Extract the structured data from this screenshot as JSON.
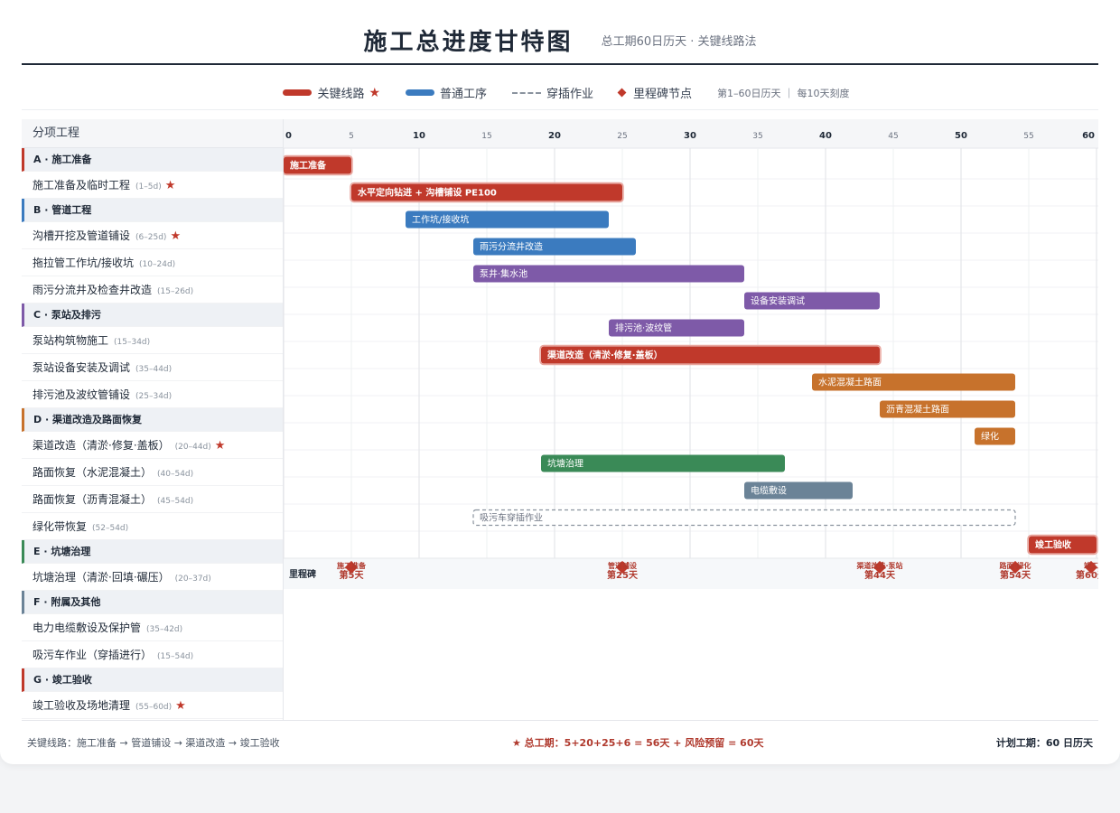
{
  "header": {
    "title": "施工总进度甘特图",
    "subtitle": "总工期60日历天 · 关键线路法"
  },
  "legend": {
    "critical": "关键线路",
    "normal": "普通工序",
    "inserted": "穿插作业",
    "milestone": "里程碑节点",
    "star": "★",
    "note": "第1–60日历天 ｜ 每10天刻度"
  },
  "left_header": "分项工程",
  "colors": {
    "critical": "#c0392b",
    "blue": "#3b7bbf",
    "purple": "#7e5aa8",
    "orange": "#c7722c",
    "green": "#3a8a57",
    "slate": "#6b8397",
    "dash": "#8a939e"
  },
  "rows": [
    {
      "type": "group",
      "label": "A · 施工准备",
      "color": "#c0392b"
    },
    {
      "type": "task",
      "label": "施工准备及临时工程",
      "dur": "(1–5d)",
      "critical": true
    },
    {
      "type": "group",
      "label": "B · 管道工程",
      "color": "#3b7bbf"
    },
    {
      "type": "task",
      "label": "沟槽开挖及管道铺设",
      "dur": "(6–25d)",
      "critical": true
    },
    {
      "type": "task",
      "label": "拖拉管工作坑/接收坑",
      "dur": "(10–24d)",
      "critical": false
    },
    {
      "type": "task",
      "label": "雨污分流井及检查井改造",
      "dur": "(15–26d)",
      "critical": false
    },
    {
      "type": "group",
      "label": "C · 泵站及排污",
      "color": "#7e5aa8"
    },
    {
      "type": "task",
      "label": "泵站构筑物施工",
      "dur": "(15–34d)",
      "critical": false
    },
    {
      "type": "task",
      "label": "泵站设备安装及调试",
      "dur": "(35–44d)",
      "critical": false
    },
    {
      "type": "task",
      "label": "排污池及波纹管铺设",
      "dur": "(25–34d)",
      "critical": false
    },
    {
      "type": "group",
      "label": "D · 渠道改造及路面恢复",
      "color": "#c7722c"
    },
    {
      "type": "task",
      "label": "渠道改造（清淤·修复·盖板）",
      "dur": "(20–44d)",
      "critical": true
    },
    {
      "type": "task",
      "label": "路面恢复（水泥混凝土）",
      "dur": "(40–54d)",
      "critical": false
    },
    {
      "type": "task",
      "label": "路面恢复（沥青混凝土）",
      "dur": "(45–54d)",
      "critical": false
    },
    {
      "type": "task",
      "label": "绿化带恢复",
      "dur": "(52–54d)",
      "critical": false
    },
    {
      "type": "group",
      "label": "E · 坑塘治理",
      "color": "#3a8a57"
    },
    {
      "type": "task",
      "label": "坑塘治理（清淤·回填·碾压）",
      "dur": "(20–37d)",
      "critical": false
    },
    {
      "type": "group",
      "label": "F · 附属及其他",
      "color": "#6b8397"
    },
    {
      "type": "task",
      "label": "电力电缆敷设及保护管",
      "dur": "(35–42d)",
      "critical": false
    },
    {
      "type": "task",
      "label": "吸污车作业（穿插进行）",
      "dur": "(15–54d)",
      "critical": false
    },
    {
      "type": "group",
      "label": "G · 竣工验收",
      "color": "#c0392b"
    },
    {
      "type": "task",
      "label": "竣工验收及场地清理",
      "dur": "(55–60d)",
      "critical": true
    }
  ],
  "chart_data": {
    "type": "gantt",
    "x_range": [
      0,
      60
    ],
    "ticks": [
      0,
      5,
      10,
      15,
      20,
      25,
      30,
      35,
      40,
      45,
      50,
      55,
      60
    ],
    "bars": [
      {
        "label": "施工准备",
        "start": 0,
        "end": 5,
        "color": "#c0392b",
        "critical": true
      },
      {
        "label": "水平定向钻进 + 沟槽铺设 PE100",
        "start": 5,
        "end": 25,
        "color": "#c0392b",
        "critical": true
      },
      {
        "label": "工作坑/接收坑",
        "start": 9,
        "end": 24,
        "color": "#3b7bbf",
        "critical": false
      },
      {
        "label": "雨污分流井改造",
        "start": 14,
        "end": 26,
        "color": "#3b7bbf",
        "critical": false
      },
      {
        "label": "泵井·集水池",
        "start": 14,
        "end": 34,
        "color": "#7e5aa8",
        "critical": false
      },
      {
        "label": "设备安装调试",
        "start": 34,
        "end": 44,
        "color": "#7e5aa8",
        "critical": false
      },
      {
        "label": "排污池·波纹管",
        "start": 24,
        "end": 34,
        "color": "#7e5aa8",
        "critical": false
      },
      {
        "label": "渠道改造（清淤·修复·盖板）",
        "start": 19,
        "end": 44,
        "color": "#c0392b",
        "critical": true
      },
      {
        "label": "水泥混凝土路面",
        "start": 39,
        "end": 54,
        "color": "#c7722c",
        "critical": false
      },
      {
        "label": "沥青混凝土路面",
        "start": 44,
        "end": 54,
        "color": "#c7722c",
        "critical": false
      },
      {
        "label": "绿化",
        "start": 51,
        "end": 54,
        "color": "#c7722c",
        "critical": false
      },
      {
        "label": "坑塘治理",
        "start": 19,
        "end": 37,
        "color": "#3a8a57",
        "critical": false
      },
      {
        "label": "电缆敷设",
        "start": 34,
        "end": 42,
        "color": "#6b8397",
        "critical": false
      },
      {
        "label": "吸污车穿插作业",
        "start": 14,
        "end": 54,
        "color": "#8a939e",
        "critical": false,
        "dashed": true
      },
      {
        "label": "竣工验收",
        "start": 55,
        "end": 60,
        "color": "#c0392b",
        "critical": true
      }
    ],
    "milestones_label": "里程碑",
    "milestones": [
      {
        "day": 5,
        "name": "施工准备",
        "text": "第5天"
      },
      {
        "day": 25,
        "name": "管道铺设",
        "text": "第25天"
      },
      {
        "day": 44,
        "name": "渠道改造·泵站",
        "text": "第44天"
      },
      {
        "day": 54,
        "name": "路面·绿化",
        "text": "第54天"
      },
      {
        "day": 60,
        "name": "竣工",
        "text": "第60天"
      }
    ]
  },
  "footer": {
    "left": "关键线路：施工准备 → 管道铺设 → 渠道改造 → 竣工验收",
    "middle": "★ 总工期：5+20+25+6 = 56天 + 风险预留 = 60天",
    "right_label": "计划工期：",
    "right_value": "60 日历天"
  }
}
